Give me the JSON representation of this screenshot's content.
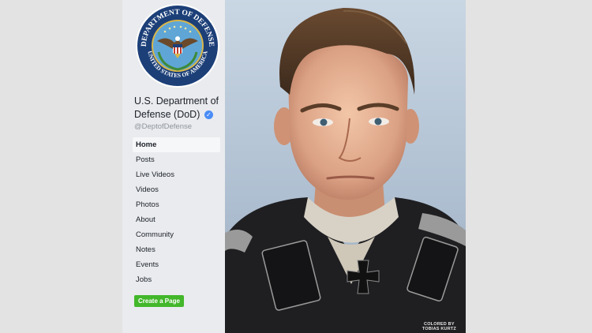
{
  "page": {
    "name": "U.S. Department of Defense (DoD)",
    "handle": "@DeptofDefense",
    "verified_icon": "verified-badge-icon"
  },
  "seal": {
    "top_text": "DEPARTMENT OF DEFENSE",
    "bottom_text": "UNITED STATES OF AMERICA",
    "colors": {
      "ring": "#1c3f78",
      "field": "#5fa6d6",
      "gold": "#d9b64a"
    }
  },
  "nav": {
    "items": [
      {
        "label": "Home",
        "active": true
      },
      {
        "label": "Posts"
      },
      {
        "label": "Live Videos"
      },
      {
        "label": "Videos"
      },
      {
        "label": "Photos"
      },
      {
        "label": "About"
      },
      {
        "label": "Community"
      },
      {
        "label": "Notes"
      },
      {
        "label": "Events"
      },
      {
        "label": "Jobs"
      }
    ]
  },
  "create_page_label": "Create a Page",
  "photo": {
    "credit_line1": "COLORED BY",
    "credit_line2": "TOBIAS KURTZ"
  },
  "colors": {
    "accent_green": "#42b72a",
    "verified_blue": "#4a8cf7",
    "sidebar_bg": "#e9ebee"
  }
}
